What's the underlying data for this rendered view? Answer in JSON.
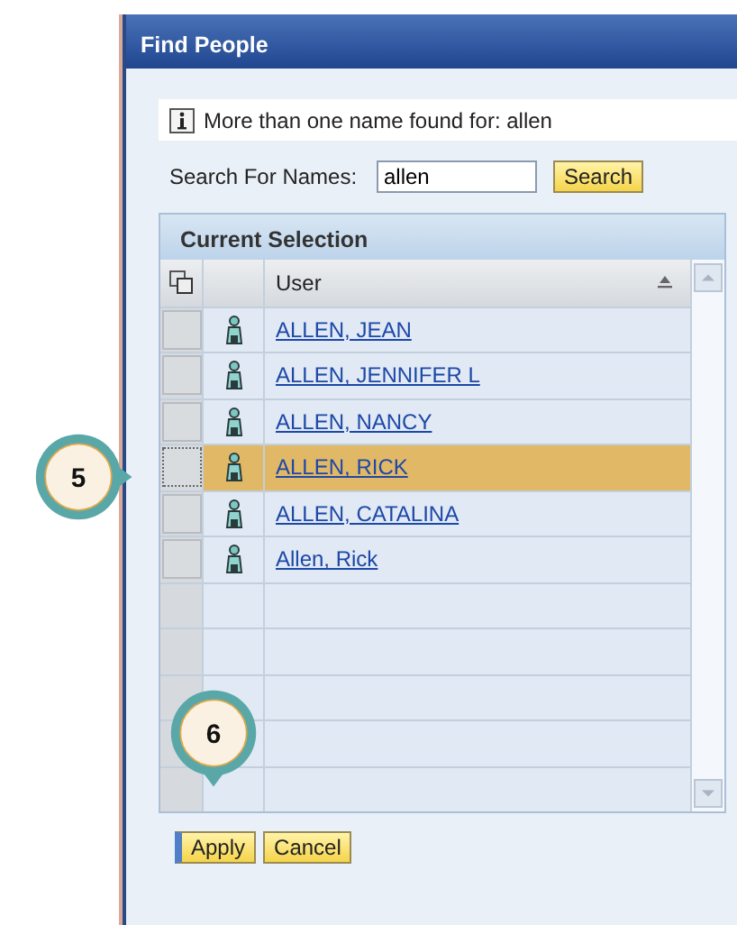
{
  "window": {
    "title": "Find People"
  },
  "message": {
    "text": "More than one name found for: allen"
  },
  "search": {
    "label": "Search For Names:",
    "value": "allen",
    "button": "Search"
  },
  "table": {
    "title": "Current Selection",
    "columns": [
      {
        "label": "User"
      }
    ],
    "rows": [
      {
        "user": "ALLEN, JEAN",
        "selected": false
      },
      {
        "user": "ALLEN, JENNIFER L",
        "selected": false
      },
      {
        "user": "ALLEN, NANCY",
        "selected": false
      },
      {
        "user": "ALLEN, RICK",
        "selected": true
      },
      {
        "user": "ALLEN, CATALINA",
        "selected": false
      },
      {
        "user": "Allen, Rick",
        "selected": false
      }
    ]
  },
  "buttons": [
    {
      "label": "Apply",
      "focused": true
    },
    {
      "label": "Cancel",
      "focused": false
    }
  ],
  "callouts": [
    {
      "label": "5",
      "kind": "left"
    },
    {
      "label": "6",
      "kind": "down"
    }
  ]
}
